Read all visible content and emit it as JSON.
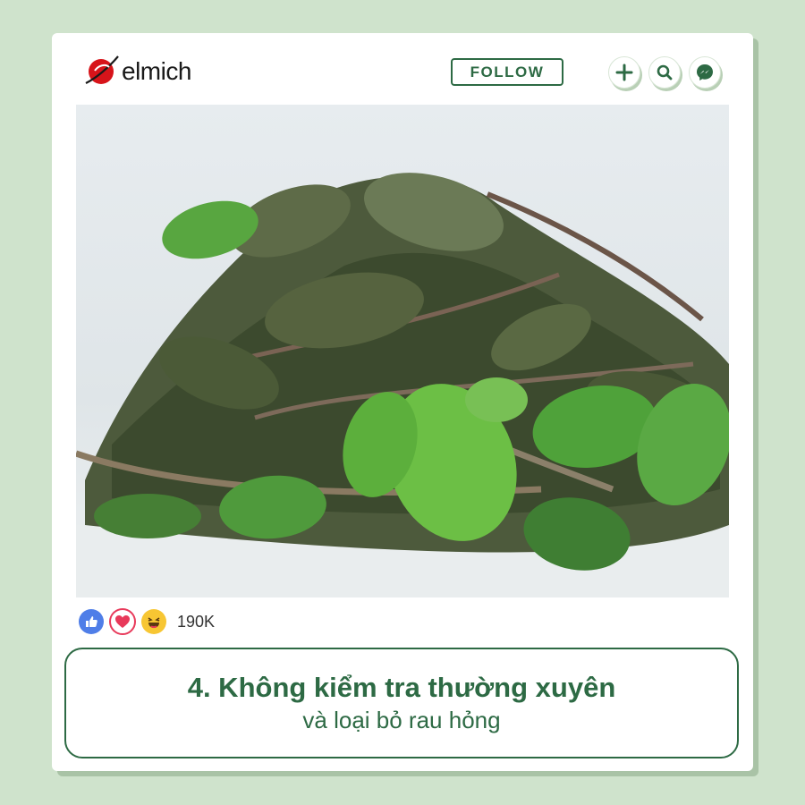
{
  "brand": {
    "name": "elmich",
    "logo_color": "#d7141a"
  },
  "header": {
    "follow_label": "FOLLOW",
    "icons": [
      "plus-icon",
      "search-icon",
      "messenger-icon"
    ],
    "accent": "#2d6a44"
  },
  "photo": {
    "subject": "dried-mint-leaves-image"
  },
  "reactions": {
    "icons": [
      "like-icon",
      "love-icon",
      "haha-icon"
    ],
    "count": "190K"
  },
  "caption": {
    "title": "4. Không kiểm tra thường xuyên",
    "subtitle": "và loại bỏ rau hỏng"
  },
  "colors": {
    "background": "#cfe3cc",
    "card": "#ffffff",
    "accent": "#2d6a44"
  }
}
